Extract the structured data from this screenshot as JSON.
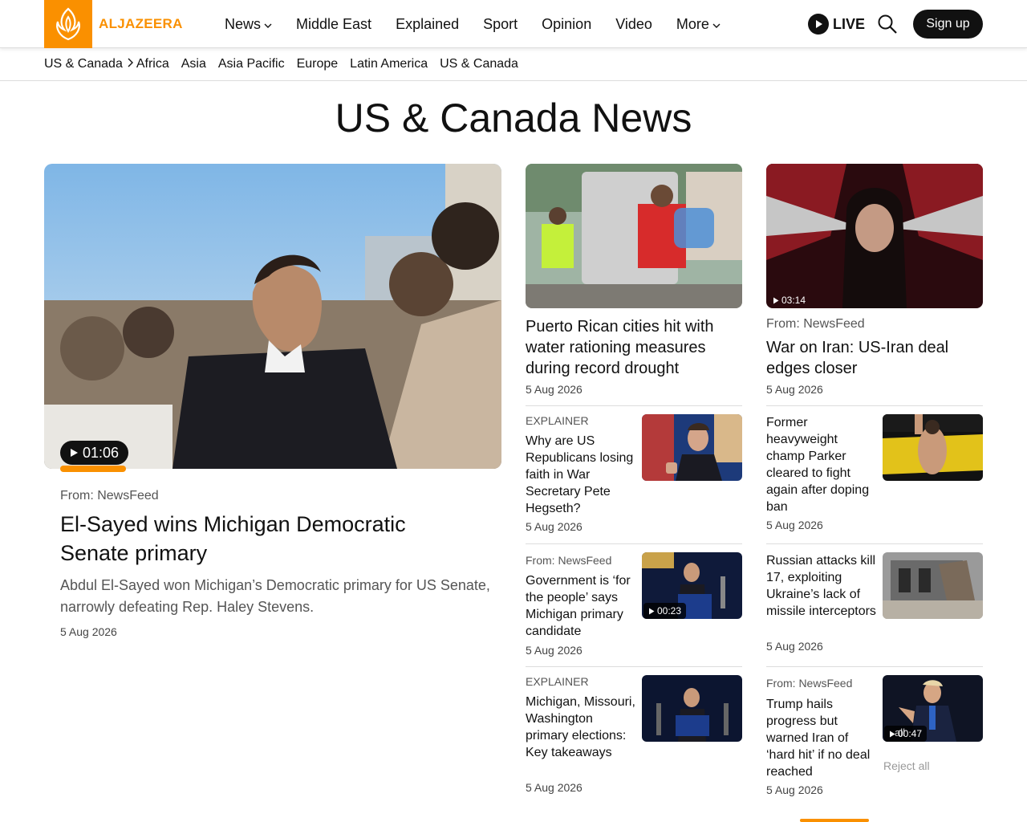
{
  "colors": {
    "brand": "#fa9000",
    "text": "#111111",
    "muted": "#555555"
  },
  "header": {
    "logo_text": "ALJAZEERA",
    "nav": [
      {
        "label": "News",
        "has_dropdown": true
      },
      {
        "label": "Middle East"
      },
      {
        "label": "Explained"
      },
      {
        "label": "Sport"
      },
      {
        "label": "Opinion"
      },
      {
        "label": "Video"
      },
      {
        "label": "More",
        "has_dropdown": true
      }
    ],
    "live_label": "LIVE",
    "signup_label": "Sign up"
  },
  "subnav": {
    "current": "US & Canada",
    "items": [
      "Africa",
      "Asia",
      "Asia Pacific",
      "Europe",
      "Latin America",
      "US & Canada"
    ]
  },
  "page_title": "US & Canada News",
  "featured": {
    "duration": "01:06",
    "source": "From: NewsFeed",
    "title": "El-Sayed wins Michigan Democratic Senate primary",
    "summary": "Abdul El-Sayed won Michigan’s Democratic primary for US Senate, narrowly defeating Rep. Haley Stevens.",
    "date": "5 Aug 2026"
  },
  "col2_top": {
    "title": "Puerto Rican cities hit with water rationing measures during record drought",
    "date": "5 Aug 2026"
  },
  "col3_top": {
    "duration": "03:14",
    "source": "From: NewsFeed",
    "title": "War on Iran: US-Iran deal edges closer",
    "date": "5 Aug 2026"
  },
  "col2_list": [
    {
      "kicker": "EXPLAINER",
      "title": "Why are US Republicans losing faith in War Secretary Pete Hegseth?",
      "date": "5 Aug 2026"
    },
    {
      "kicker": "From: NewsFeed",
      "title": "Government is ‘for the people’ says Michigan primary candidate",
      "date": "5 Aug 2026",
      "duration": "00:23"
    },
    {
      "kicker": "EXPLAINER",
      "title": "Michigan, Missouri, Washington primary elections: Key takeaways",
      "date": "5 Aug 2026"
    }
  ],
  "col3_list": [
    {
      "title": "Former heavyweight champ Parker cleared to fight again after doping ban",
      "date": "5 Aug 2026"
    },
    {
      "title": "Russian attacks kill 17, exploiting Ukraine’s lack of missile interceptors",
      "date": "5 Aug 2026"
    },
    {
      "kicker": "From: NewsFeed",
      "title": "Trump hails progress but warned Iran of ‘hard hit’ if no deal reached",
      "date": "5 Aug 2026",
      "duration": "00:47"
    }
  ],
  "cookie": {
    "reject_all": "Reject all",
    "ghost_text": "all"
  }
}
